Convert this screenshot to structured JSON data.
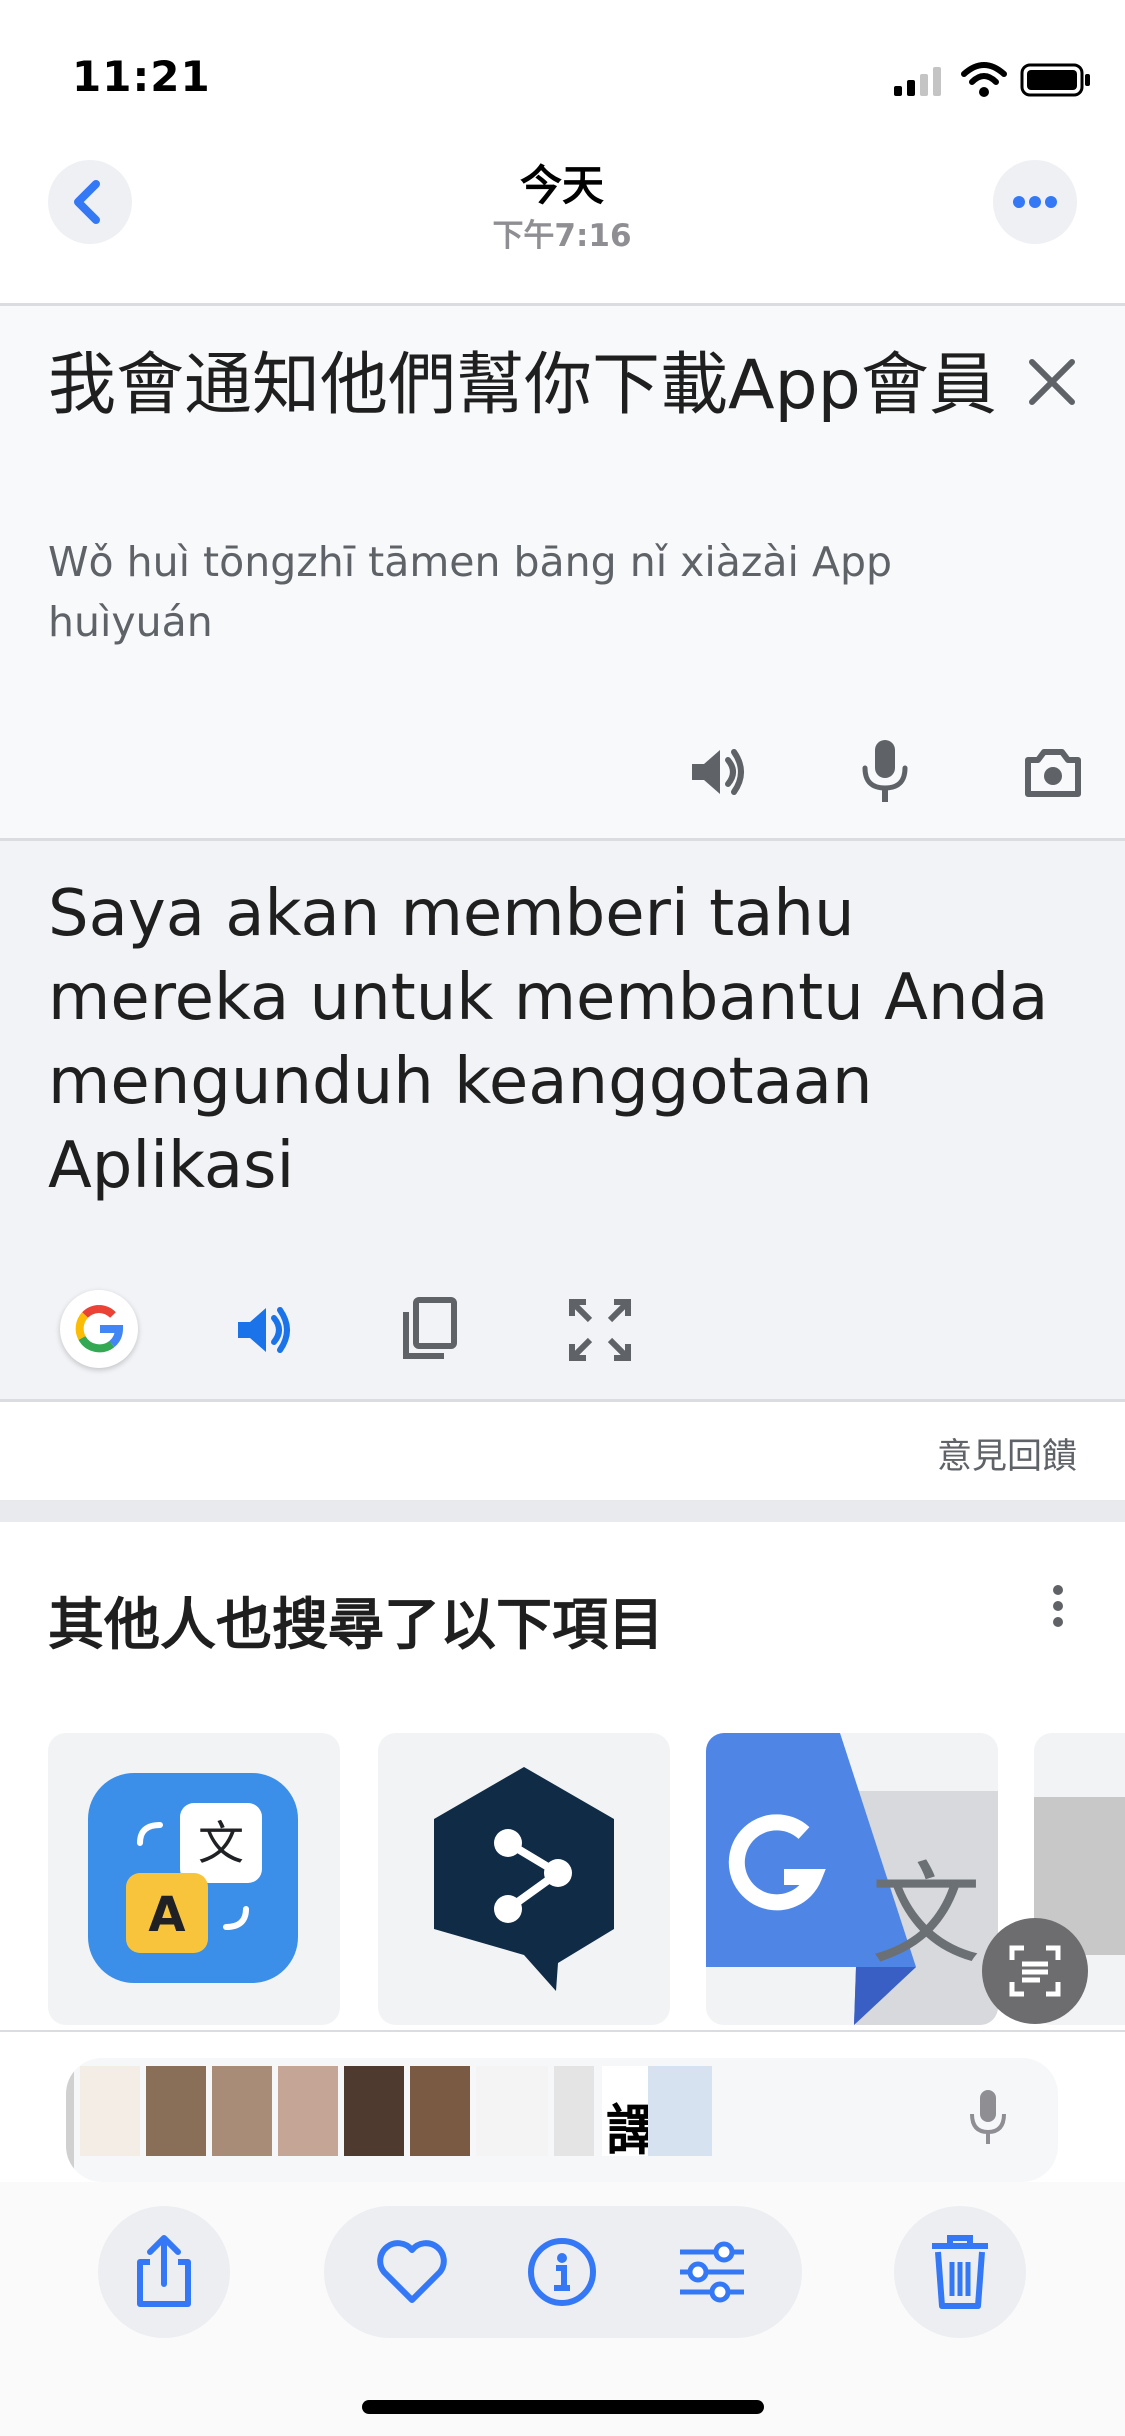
{
  "status_bar": {
    "time": "11:21"
  },
  "nav": {
    "title": "今天",
    "subtitle": "下午7:16"
  },
  "source": {
    "text": "我會通知他們幫你下載App會員",
    "romanization": "Wǒ huì tōngzhī tāmen bāng nǐ xiàzài App huìyuán"
  },
  "translation": {
    "text": "Saya akan memberi tahu mereka untuk membantu Anda mengunduh keanggotaan Aplikasi"
  },
  "feedback_label": "意見回饋",
  "related": {
    "title": "其他人也搜尋了以下項目"
  },
  "strip_glyphs": {
    "partial_char": "譯"
  },
  "colors": {
    "accent_blue": "#1a73e8",
    "ios_blue": "#3478f6",
    "panel_source": "#f8f9fb",
    "panel_translation": "#f1f3f6"
  },
  "icons": [
    "back-chevron-icon",
    "more-icon",
    "close-icon",
    "speaker-icon",
    "mic-icon",
    "camera-icon",
    "google-logo-icon",
    "copy-icon",
    "fullscreen-icon",
    "menu-dots-icon",
    "live-text-icon",
    "share-icon",
    "heart-icon",
    "info-icon",
    "adjust-icon",
    "trash-icon"
  ]
}
